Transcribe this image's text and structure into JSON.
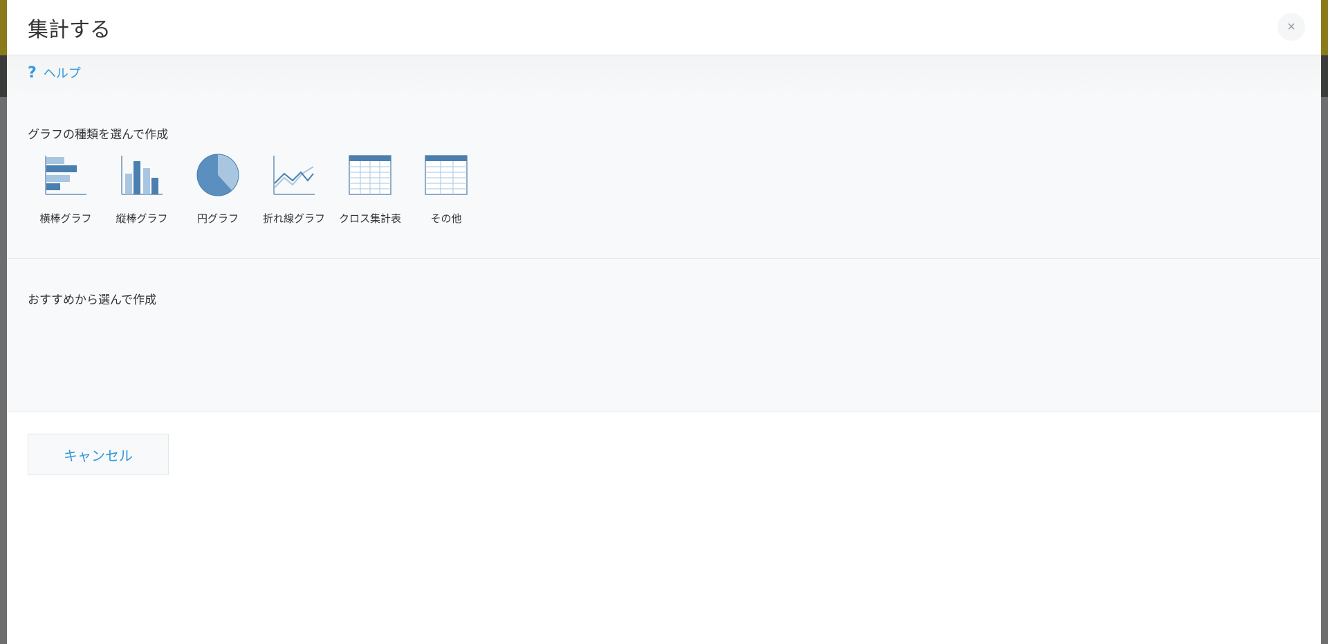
{
  "dialog": {
    "title": "集計する",
    "close_label": "×"
  },
  "help": {
    "icon": "?",
    "label": "ヘルプ"
  },
  "sections": {
    "chart_types": {
      "label": "グラフの種類を選んで作成",
      "items": [
        {
          "label": "横棒グラフ",
          "icon": "horizontal-bar-chart-icon"
        },
        {
          "label": "縦棒グラフ",
          "icon": "vertical-bar-chart-icon"
        },
        {
          "label": "円グラフ",
          "icon": "pie-chart-icon"
        },
        {
          "label": "折れ線グラフ",
          "icon": "line-chart-icon"
        },
        {
          "label": "クロス集計表",
          "icon": "cross-table-icon"
        },
        {
          "label": "その他",
          "icon": "table-icon"
        }
      ]
    },
    "recommended": {
      "label": "おすすめから選んで作成"
    }
  },
  "footer": {
    "cancel_label": "キャンセル"
  },
  "colors": {
    "accent": "#3498db",
    "icon_dark": "#4a7fb0",
    "icon_light": "#a9c6e0"
  }
}
